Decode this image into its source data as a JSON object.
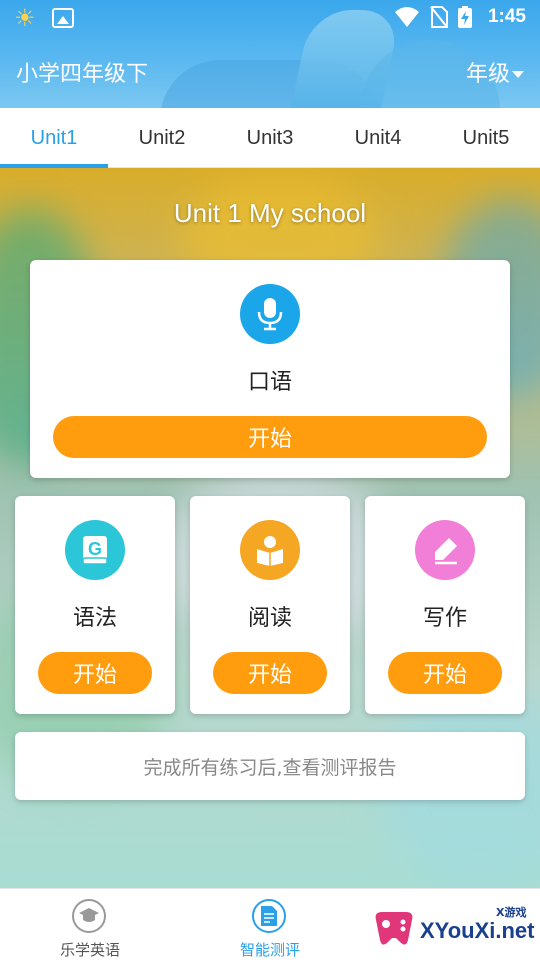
{
  "status_bar": {
    "time": "1:45"
  },
  "header": {
    "title": "小学四年级下",
    "grade_selector": "年级"
  },
  "tabs": [
    {
      "label": "Unit1",
      "active": true
    },
    {
      "label": "Unit2",
      "active": false
    },
    {
      "label": "Unit3",
      "active": false
    },
    {
      "label": "Unit4",
      "active": false
    },
    {
      "label": "Unit5",
      "active": false
    }
  ],
  "unit": {
    "title": "Unit 1 My school"
  },
  "modules": {
    "speaking": {
      "label": "口语",
      "button": "开始",
      "icon": "microphone-icon",
      "color": "#1aa6e8"
    },
    "grammar": {
      "label": "语法",
      "button": "开始",
      "icon": "grammar-book-icon",
      "color": "#2bc6d8"
    },
    "reading": {
      "label": "阅读",
      "button": "开始",
      "icon": "reading-person-icon",
      "color": "#f5a623"
    },
    "writing": {
      "label": "写作",
      "button": "开始",
      "icon": "pen-write-icon",
      "color": "#f17fd8"
    }
  },
  "report": {
    "text": "完成所有练习后,查看测评报告"
  },
  "bottom_nav": [
    {
      "label": "乐学英语",
      "icon": "graduation-cap-icon",
      "active": false
    },
    {
      "label": "智能测评",
      "icon": "document-test-icon",
      "active": true
    }
  ],
  "watermark": {
    "text": "XYouXi.net",
    "small": "X游戏"
  },
  "colors": {
    "accent": "#2aa0e8",
    "button": "#ff9d0e"
  }
}
